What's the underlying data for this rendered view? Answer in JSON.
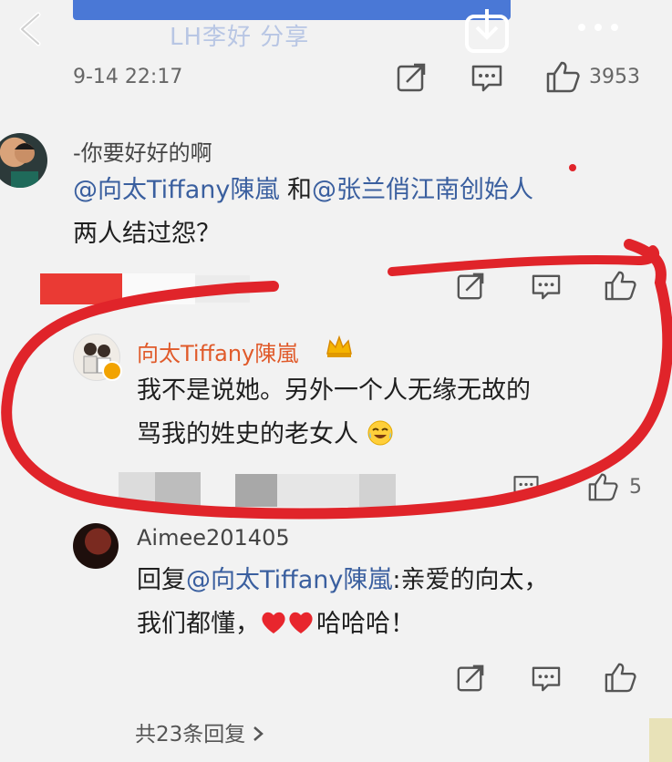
{
  "header": {
    "title": "LH李好 分享",
    "back_icon": "chevron-left-icon",
    "download_icon": "download-icon",
    "more_icon": "more-dots-icon"
  },
  "post": {
    "time": "9-14 22:17",
    "like_count": "3953"
  },
  "comments": [
    {
      "user": "-你要好好的啊",
      "mention_1": "@向太Tiffany陳嵐",
      "joiner": " 和",
      "mention_2": "@张兰俏江南创始人",
      "text_2": "两人结过怨？"
    },
    {
      "user": "向太Tiffany陳嵐",
      "badge_icon": "crown-icon",
      "line_1": "我不是说她。另外一个人无缘无故的",
      "line_2": "骂我的姓史的老女人",
      "emoji": "laugh-cry-emoji",
      "like_count": "5"
    },
    {
      "user": "Aimee201405",
      "reply_prefix": "回复",
      "reply_mention": "@向太Tiffany陳嵐",
      "reply_text": ":亲爱的向太，",
      "line_2_start": "我们都懂，",
      "line_2_end": "哈哈哈！"
    }
  ],
  "footer": {
    "more_replies": "共23条回复",
    "more_replies_icon": "chevron-right-icon"
  },
  "colors": {
    "accent_red": "#e0242a",
    "mention_blue": "#3a5f9f",
    "top_strip_blue": "#4a78d6"
  }
}
